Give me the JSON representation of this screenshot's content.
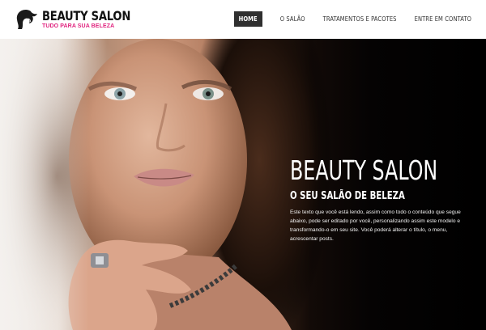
{
  "header": {
    "brand": "BEAUTY SALON",
    "tagline": "TUDO PARA SUA BELEZA",
    "logo_icon": "woman-silhouette-icon"
  },
  "nav": {
    "items": [
      {
        "label": "HOME",
        "active": true
      },
      {
        "label": "O SALÃO",
        "active": false
      },
      {
        "label": "TRATAMENTOS E PACOTES",
        "active": false
      },
      {
        "label": "ENTRE EM CONTATO",
        "active": false
      }
    ]
  },
  "hero": {
    "title": "BEAUTY SALON",
    "subtitle": "O SEU SALÃO DE BELEZA",
    "body": "Este texto que você está lendo, assim como todo o conteúdo que segue abaixo, pode ser editado por você, personalizando assim este modelo e transformando-o em seu site. Você poderá alterar o título, o menu, acrescentar posts.",
    "image": "woman-portrait-photo"
  },
  "colors": {
    "accent": "#e0237e",
    "nav_active_bg": "#2f2f2f",
    "header_bg": "#ffffff",
    "hero_bg_right": "#000000"
  }
}
